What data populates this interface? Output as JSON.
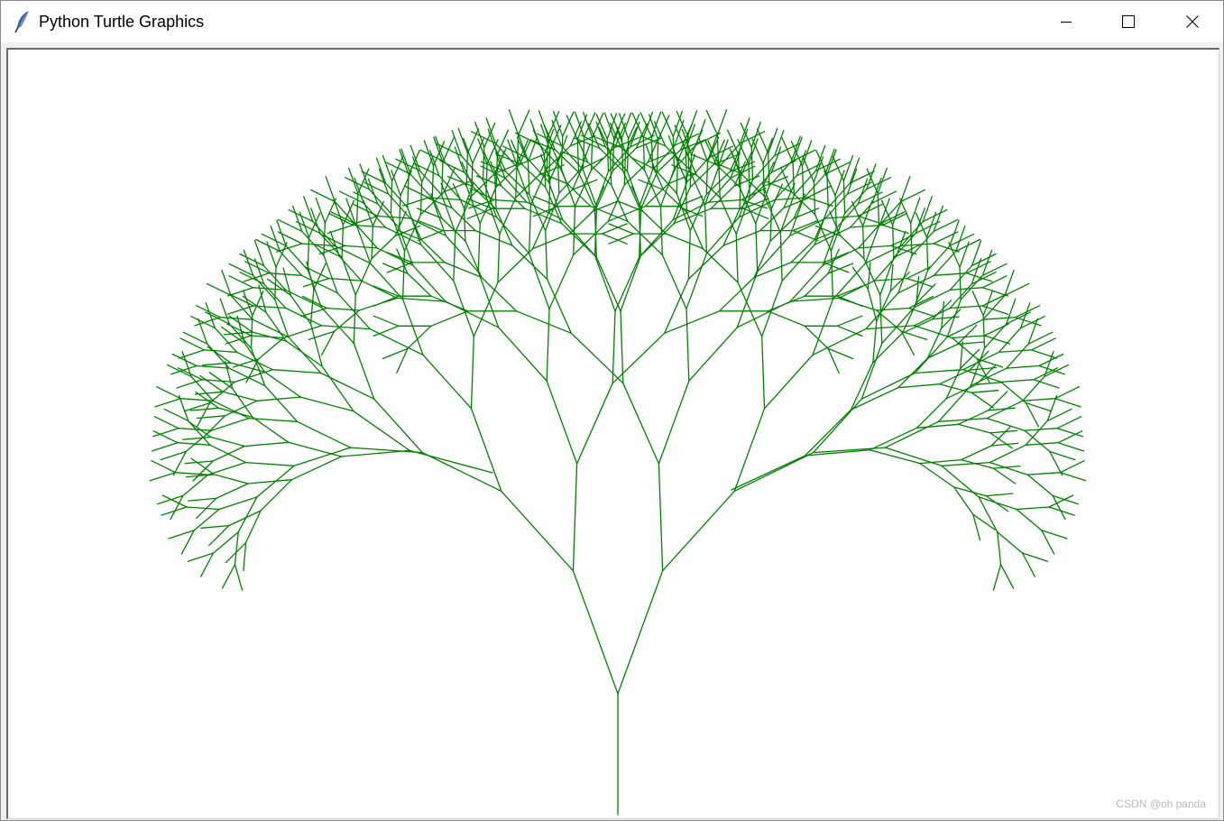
{
  "window": {
    "title": "Python Turtle Graphics",
    "icon": "feather-icon",
    "controls": {
      "minimize": "minimize-icon",
      "maximize": "maximize-icon",
      "close": "close-icon"
    }
  },
  "canvas": {
    "background": "#ffffff",
    "pen_color": "#008000"
  },
  "watermark": "CSDN @oh panda"
}
